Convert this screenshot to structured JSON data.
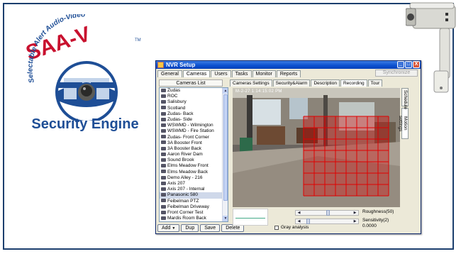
{
  "logo": {
    "brand_top": "SAA-V",
    "brand_tm": "TM",
    "arc_text": "Selectable Alert Audio-Video",
    "tagline": "Security Engine",
    "colors": {
      "blue": "#1e4e96",
      "red": "#c8102e"
    }
  },
  "window": {
    "title": "NVR Setup",
    "tabs": [
      "General",
      "Cameras",
      "Users",
      "Tasks",
      "Monitor",
      "Reports"
    ],
    "active_tab": "Cameras",
    "synchronize_label": "Synchronize",
    "buttons": {
      "minimize": "_",
      "maximize": "□",
      "close": "X"
    }
  },
  "cameras": {
    "list_label": "Cameras List",
    "items": [
      "Zudas",
      "ROC",
      "Salisbury",
      "Scotland",
      "Zudas- Back",
      "Zudas- Side",
      "WSWMD - Wilmington",
      "WSWMD - Fire Station",
      "Zudas- Front Corner",
      "3A Booster Front",
      "3A Booster Back",
      "Aaron River Dam",
      "Sound Brook",
      "Elms Meadow Front",
      "Elms Meadow Back",
      "Demo Alley - 216",
      "Axis 207",
      "Axis 207 - Internal",
      "Panasonic 580",
      "Feibelman PTZ",
      "Feibelman Driveway",
      "Front Corner Test",
      "Mardis Room Back"
    ],
    "selected": "Panasonic 580",
    "add_label": "Add",
    "dup_label": "Dup",
    "save_label": "Save",
    "delete_label": "Delete"
  },
  "subtabs": {
    "items": [
      "Cameras Settings",
      "Security&Alarm",
      "Description",
      "Recording",
      "Tour"
    ],
    "active": "Recording"
  },
  "sidetabs": [
    "Schedule",
    "Motion settings"
  ],
  "controls": {
    "roughness_label": "Roughness(50)",
    "sensitivity_label": "Sensitivity(2)",
    "sensitivity_value": "0.0000",
    "gray_analysis_label": "Gray analysis",
    "roughness_level": 0.5,
    "sensitivity_level": 0.1
  }
}
